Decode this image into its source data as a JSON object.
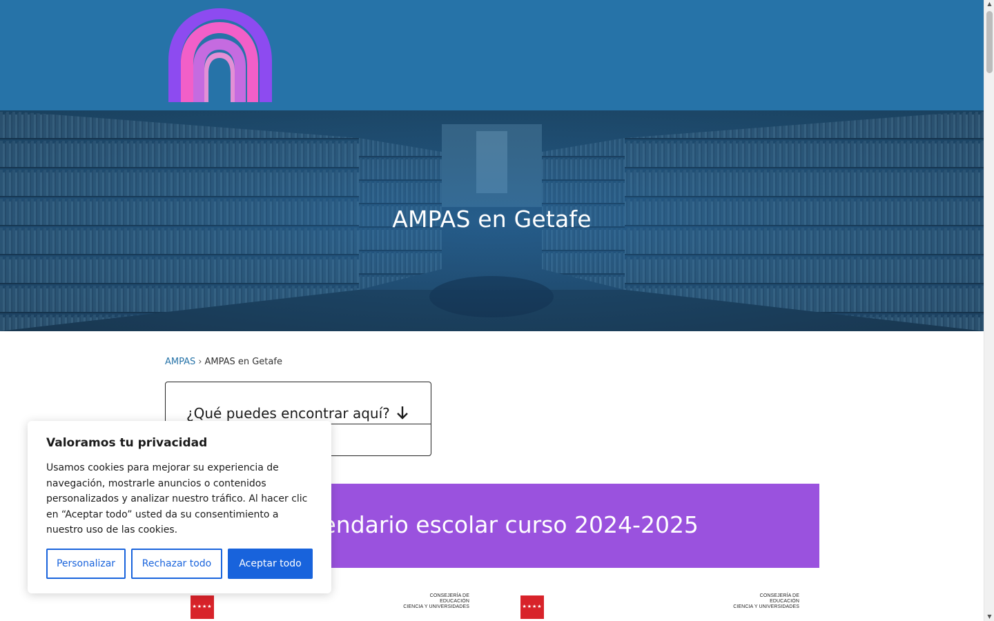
{
  "header": {
    "logo_name": "rainbow-logo"
  },
  "hero": {
    "title": "AMPAS en Getafe"
  },
  "breadcrumb": {
    "parent": "AMPAS",
    "separator": "›",
    "current": "AMPAS en Getafe"
  },
  "toc": {
    "title": "¿Qué puedes encontrar aquí?",
    "icon": "arrow-down-icon"
  },
  "banner": {
    "text": "Calendario escolar curso 2024-2025",
    "color": "#9a52de"
  },
  "logos": {
    "ministry_line1": "CONSEJERÍA DE EDUCACIÓN",
    "ministry_line2": "CIENCIA Y UNIVERSIDADES"
  },
  "cookie": {
    "title": "Valoramos tu privacidad",
    "text": "Usamos cookies para mejorar su experiencia de navegación, mostrarle anuncios o contenidos personalizados y analizar nuestro tráfico. Al hacer clic en “Aceptar todo” usted da su consentimiento a nuestro uso de las cookies.",
    "customize_label": "Personalizar",
    "reject_label": "Rechazar todo",
    "accept_label": "Aceptar todo",
    "accent_color": "#1863dc"
  },
  "colors": {
    "header_bg": "#2673a8",
    "link": "#2673a8"
  }
}
